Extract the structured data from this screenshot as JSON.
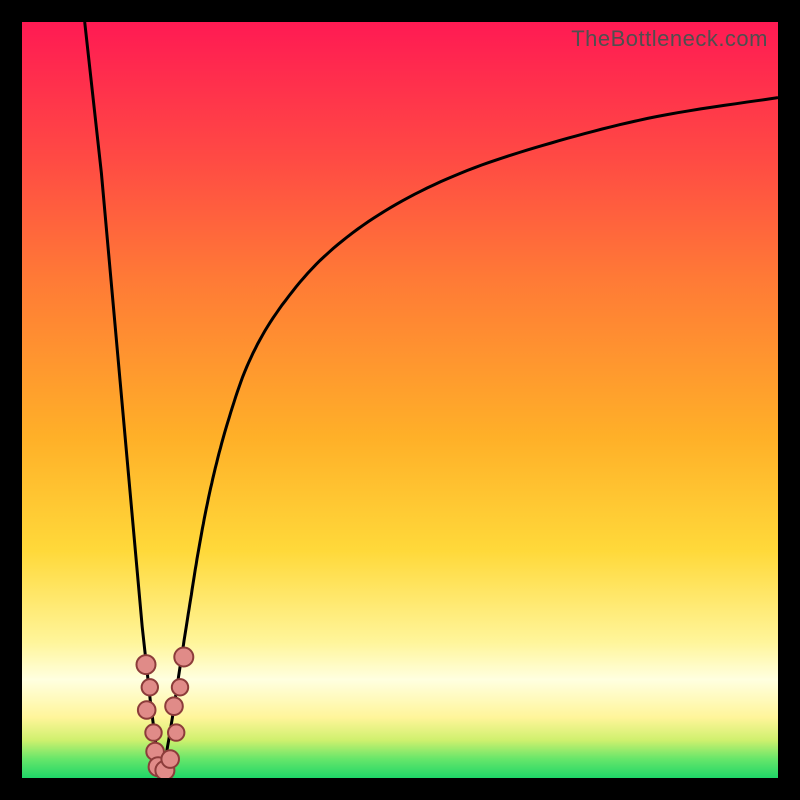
{
  "watermark": "TheBottleneck.com",
  "chart_data": {
    "type": "line",
    "title": "",
    "xlabel": "",
    "ylabel": "",
    "xlim": [
      0,
      100
    ],
    "ylim": [
      0,
      100
    ],
    "grid": false,
    "legend": false,
    "notes": "V-shaped bottleneck curve over a vertical red-to-green gradient. Minimum of the curve at x≈18.5, y≈0. Left branch descends steeply from top-left; right branch rises in a saturating curve toward upper-right. Salmon circular markers cluster near the trough.",
    "series": [
      {
        "name": "left-branch",
        "x": [
          8.3,
          10.5,
          12.3,
          14.1,
          15.9,
          17.0,
          17.9,
          18.5
        ],
        "values": [
          100,
          80,
          60,
          40,
          20,
          10,
          3,
          0
        ]
      },
      {
        "name": "right-branch",
        "x": [
          18.5,
          19.4,
          20.2,
          21.1,
          22.2,
          23.5,
          25.1,
          27.2,
          30.0,
          34.0,
          40.0,
          48.0,
          58.0,
          70.0,
          84.0,
          100.0
        ],
        "values": [
          0,
          5,
          10,
          16,
          23,
          31,
          39,
          47,
          55,
          62,
          69,
          75,
          80,
          84,
          87.5,
          90
        ]
      }
    ],
    "markers": [
      {
        "x": 16.4,
        "y": 15,
        "r": 1.4
      },
      {
        "x": 16.9,
        "y": 12,
        "r": 1.2
      },
      {
        "x": 16.5,
        "y": 9,
        "r": 1.3
      },
      {
        "x": 17.4,
        "y": 6,
        "r": 1.2
      },
      {
        "x": 17.6,
        "y": 3.5,
        "r": 1.3
      },
      {
        "x": 18.0,
        "y": 1.5,
        "r": 1.4
      },
      {
        "x": 18.9,
        "y": 1.0,
        "r": 1.4
      },
      {
        "x": 19.6,
        "y": 2.5,
        "r": 1.3
      },
      {
        "x": 20.4,
        "y": 6,
        "r": 1.2
      },
      {
        "x": 20.1,
        "y": 9.5,
        "r": 1.3
      },
      {
        "x": 20.9,
        "y": 12,
        "r": 1.2
      },
      {
        "x": 21.4,
        "y": 16,
        "r": 1.4
      }
    ]
  }
}
